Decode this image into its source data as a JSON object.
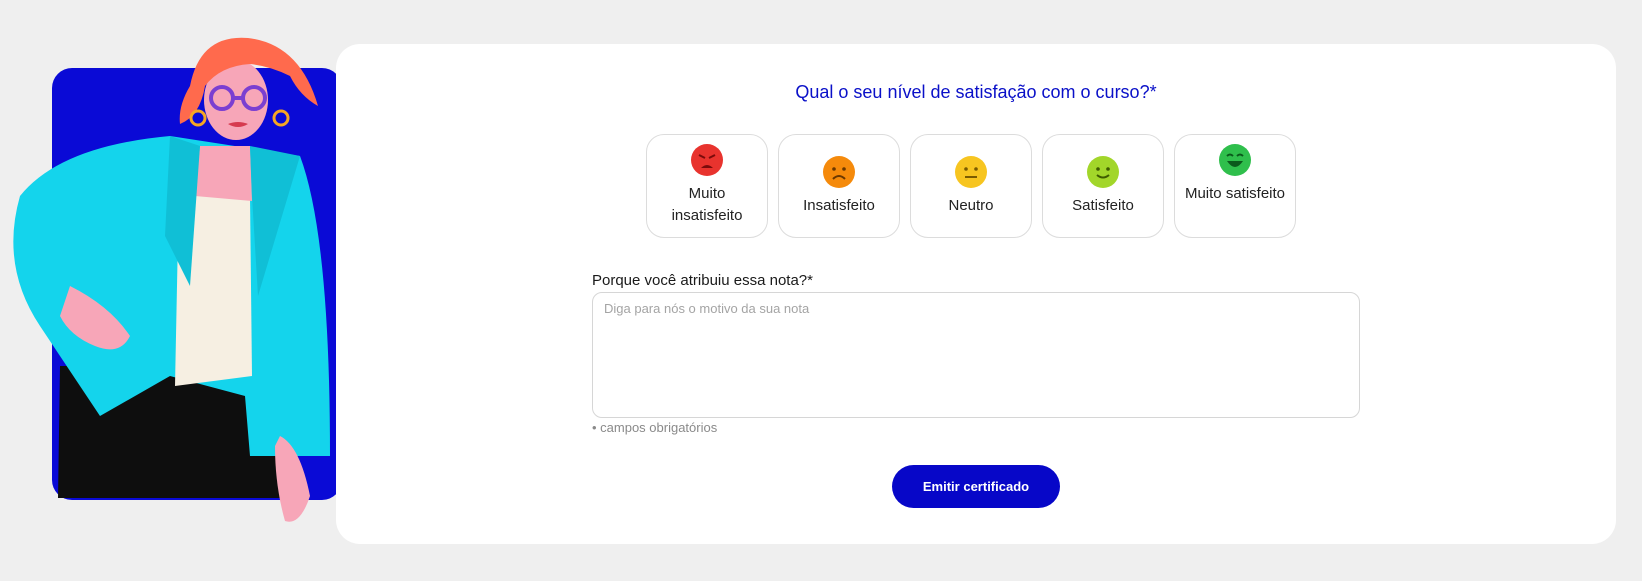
{
  "survey": {
    "question": "Qual o seu nível de satisfação com o curso?*",
    "options": [
      {
        "label": "Muito insatisfeito",
        "icon": "very-dissatisfied-face-icon",
        "color": "#e8332e"
      },
      {
        "label": "Insatisfeito",
        "icon": "dissatisfied-face-icon",
        "color": "#f58a0b"
      },
      {
        "label": "Neutro",
        "icon": "neutral-face-icon",
        "color": "#f7c520"
      },
      {
        "label": "Satisfeito",
        "icon": "satisfied-face-icon",
        "color": "#a2d62a"
      },
      {
        "label": "Muito satisfeito",
        "icon": "very-satisfied-face-icon",
        "color": "#2fbf4c"
      }
    ],
    "reason_label": "Porque você atribuiu essa nota?*",
    "reason_placeholder": "Diga para nós o motivo da sua nota",
    "reason_value": "",
    "required_note": "• campos obrigatórios",
    "submit_label": "Emitir certificado"
  },
  "colors": {
    "accent": "#0707c8",
    "background": "#efefef"
  }
}
